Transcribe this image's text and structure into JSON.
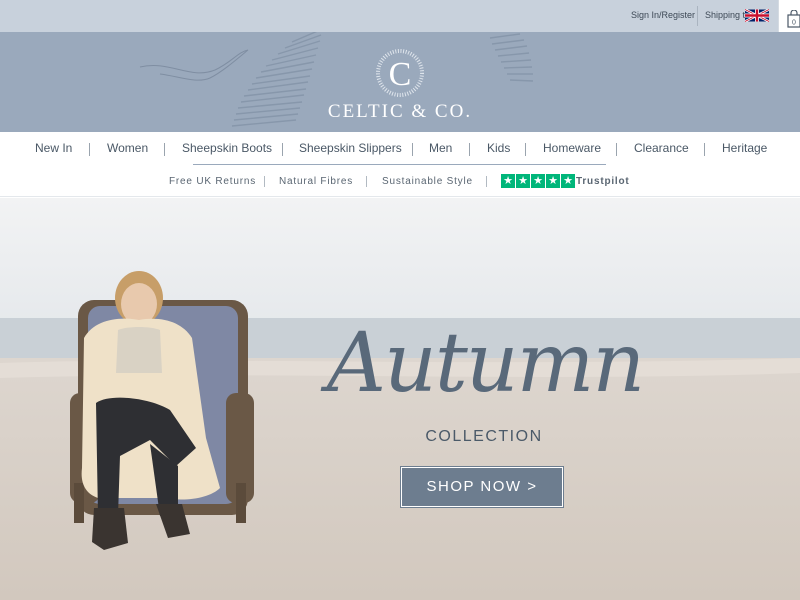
{
  "topbar": {
    "signin_label": "Sign In/Register",
    "shipping_label": "Shipping to",
    "shipping_flag": "uk-flag-icon",
    "bag_icon": "shopping-bag-icon",
    "bag_count": "0"
  },
  "header": {
    "logo_letter": "C",
    "logo_text": "CELTIC & CO.",
    "background": "#9aa9bc"
  },
  "nav": {
    "items": [
      {
        "label": "New In"
      },
      {
        "label": "Women"
      },
      {
        "label": "Sheepskin Boots"
      },
      {
        "label": "Sheepskin Slippers"
      },
      {
        "label": "Men"
      },
      {
        "label": "Kids"
      },
      {
        "label": "Homeware"
      },
      {
        "label": "Clearance"
      },
      {
        "label": "Heritage"
      }
    ]
  },
  "usp": {
    "items": [
      "Free UK Returns",
      "Natural Fibres",
      "Sustainable Style"
    ],
    "trustpilot_label": "Trustpilot",
    "trustpilot_stars": 5,
    "trustpilot_color": "#00b67a"
  },
  "hero": {
    "headline": "Autumn",
    "subheadline": "COLLECTION",
    "cta_label": "SHOP NOW >",
    "cta_color": "#6d7d8f"
  }
}
